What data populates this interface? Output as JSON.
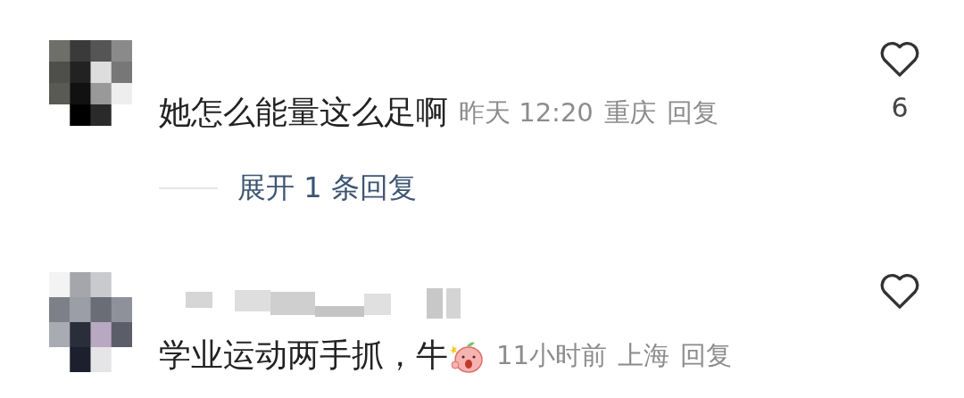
{
  "comments": [
    {
      "text": "她怎么能量这么足啊",
      "emoji": false,
      "username_blurred": false,
      "time": "昨天 12:20",
      "location": "重庆",
      "reply": "回复",
      "likes": "6",
      "expand": "展开 1 条回复"
    },
    {
      "text": "学业运动两手抓，牛",
      "emoji": true,
      "username_blurred": true,
      "time": "11小时前",
      "location": "上海",
      "reply": "回复"
    }
  ]
}
